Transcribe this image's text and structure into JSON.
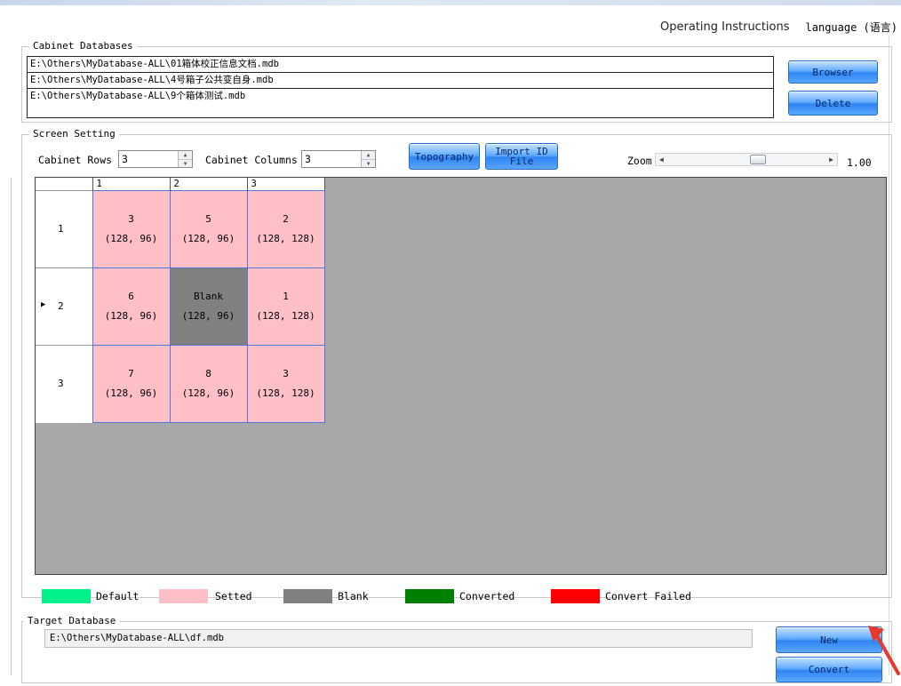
{
  "header": {
    "operating_instructions": "Operating Instructions",
    "language": "language (语言)"
  },
  "cabinet_databases": {
    "title": "Cabinet Databases",
    "entries": [
      "E:\\Others\\MyDatabase-ALL\\01箱体校正信息文档.mdb",
      "E:\\Others\\MyDatabase-ALL\\4号箱子公共变自身.mdb",
      "E:\\Others\\MyDatabase-ALL\\9个箱体测试.mdb"
    ],
    "browser_label": "Browser",
    "delete_label": "Delete"
  },
  "screen_setting": {
    "title": "Screen Setting",
    "rows_label": "Cabinet Rows",
    "rows_value": "3",
    "columns_label": "Cabinet Columns",
    "columns_value": "3",
    "topography_label": "Topography",
    "import_label_line1": "Import ID",
    "import_label_line2": "File",
    "zoom_label": "Zoom",
    "zoom_value": "1.00"
  },
  "grid": {
    "columns": [
      "1",
      "2",
      "3"
    ],
    "rows": [
      {
        "label": "1",
        "cells": [
          {
            "id": "3",
            "size": "(128, 96)",
            "state": "setted"
          },
          {
            "id": "5",
            "size": "(128, 96)",
            "state": "setted"
          },
          {
            "id": "2",
            "size": "(128, 128)",
            "state": "setted"
          }
        ]
      },
      {
        "label": "2",
        "selected": true,
        "cells": [
          {
            "id": "6",
            "size": "(128, 96)",
            "state": "setted"
          },
          {
            "id": "Blank",
            "size": "(128, 96)",
            "state": "blank"
          },
          {
            "id": "1",
            "size": "(128, 128)",
            "state": "setted"
          }
        ]
      },
      {
        "label": "3",
        "cells": [
          {
            "id": "7",
            "size": "(128, 96)",
            "state": "setted"
          },
          {
            "id": "8",
            "size": "(128, 96)",
            "state": "setted"
          },
          {
            "id": "3",
            "size": "(128, 128)",
            "state": "setted"
          }
        ]
      }
    ]
  },
  "legend": [
    {
      "label": "Default",
      "color": "#00f08c"
    },
    {
      "label": "Setted",
      "color": "#ffbfc6"
    },
    {
      "label": "Blank",
      "color": "#808080"
    },
    {
      "label": "Converted",
      "color": "#008000"
    },
    {
      "label": "Convert Failed",
      "color": "#ff0000"
    }
  ],
  "target_database": {
    "title": "Target Database",
    "path": "E:\\Others\\MyDatabase-ALL\\df.mdb",
    "new_label": "New",
    "convert_label": "Convert"
  },
  "colors": {
    "button_blue": "#3b8ef5",
    "setted": "#ffbfc6",
    "blank": "#808080",
    "grid_background": "#a8a8a8",
    "arrow": "#e8392c"
  }
}
